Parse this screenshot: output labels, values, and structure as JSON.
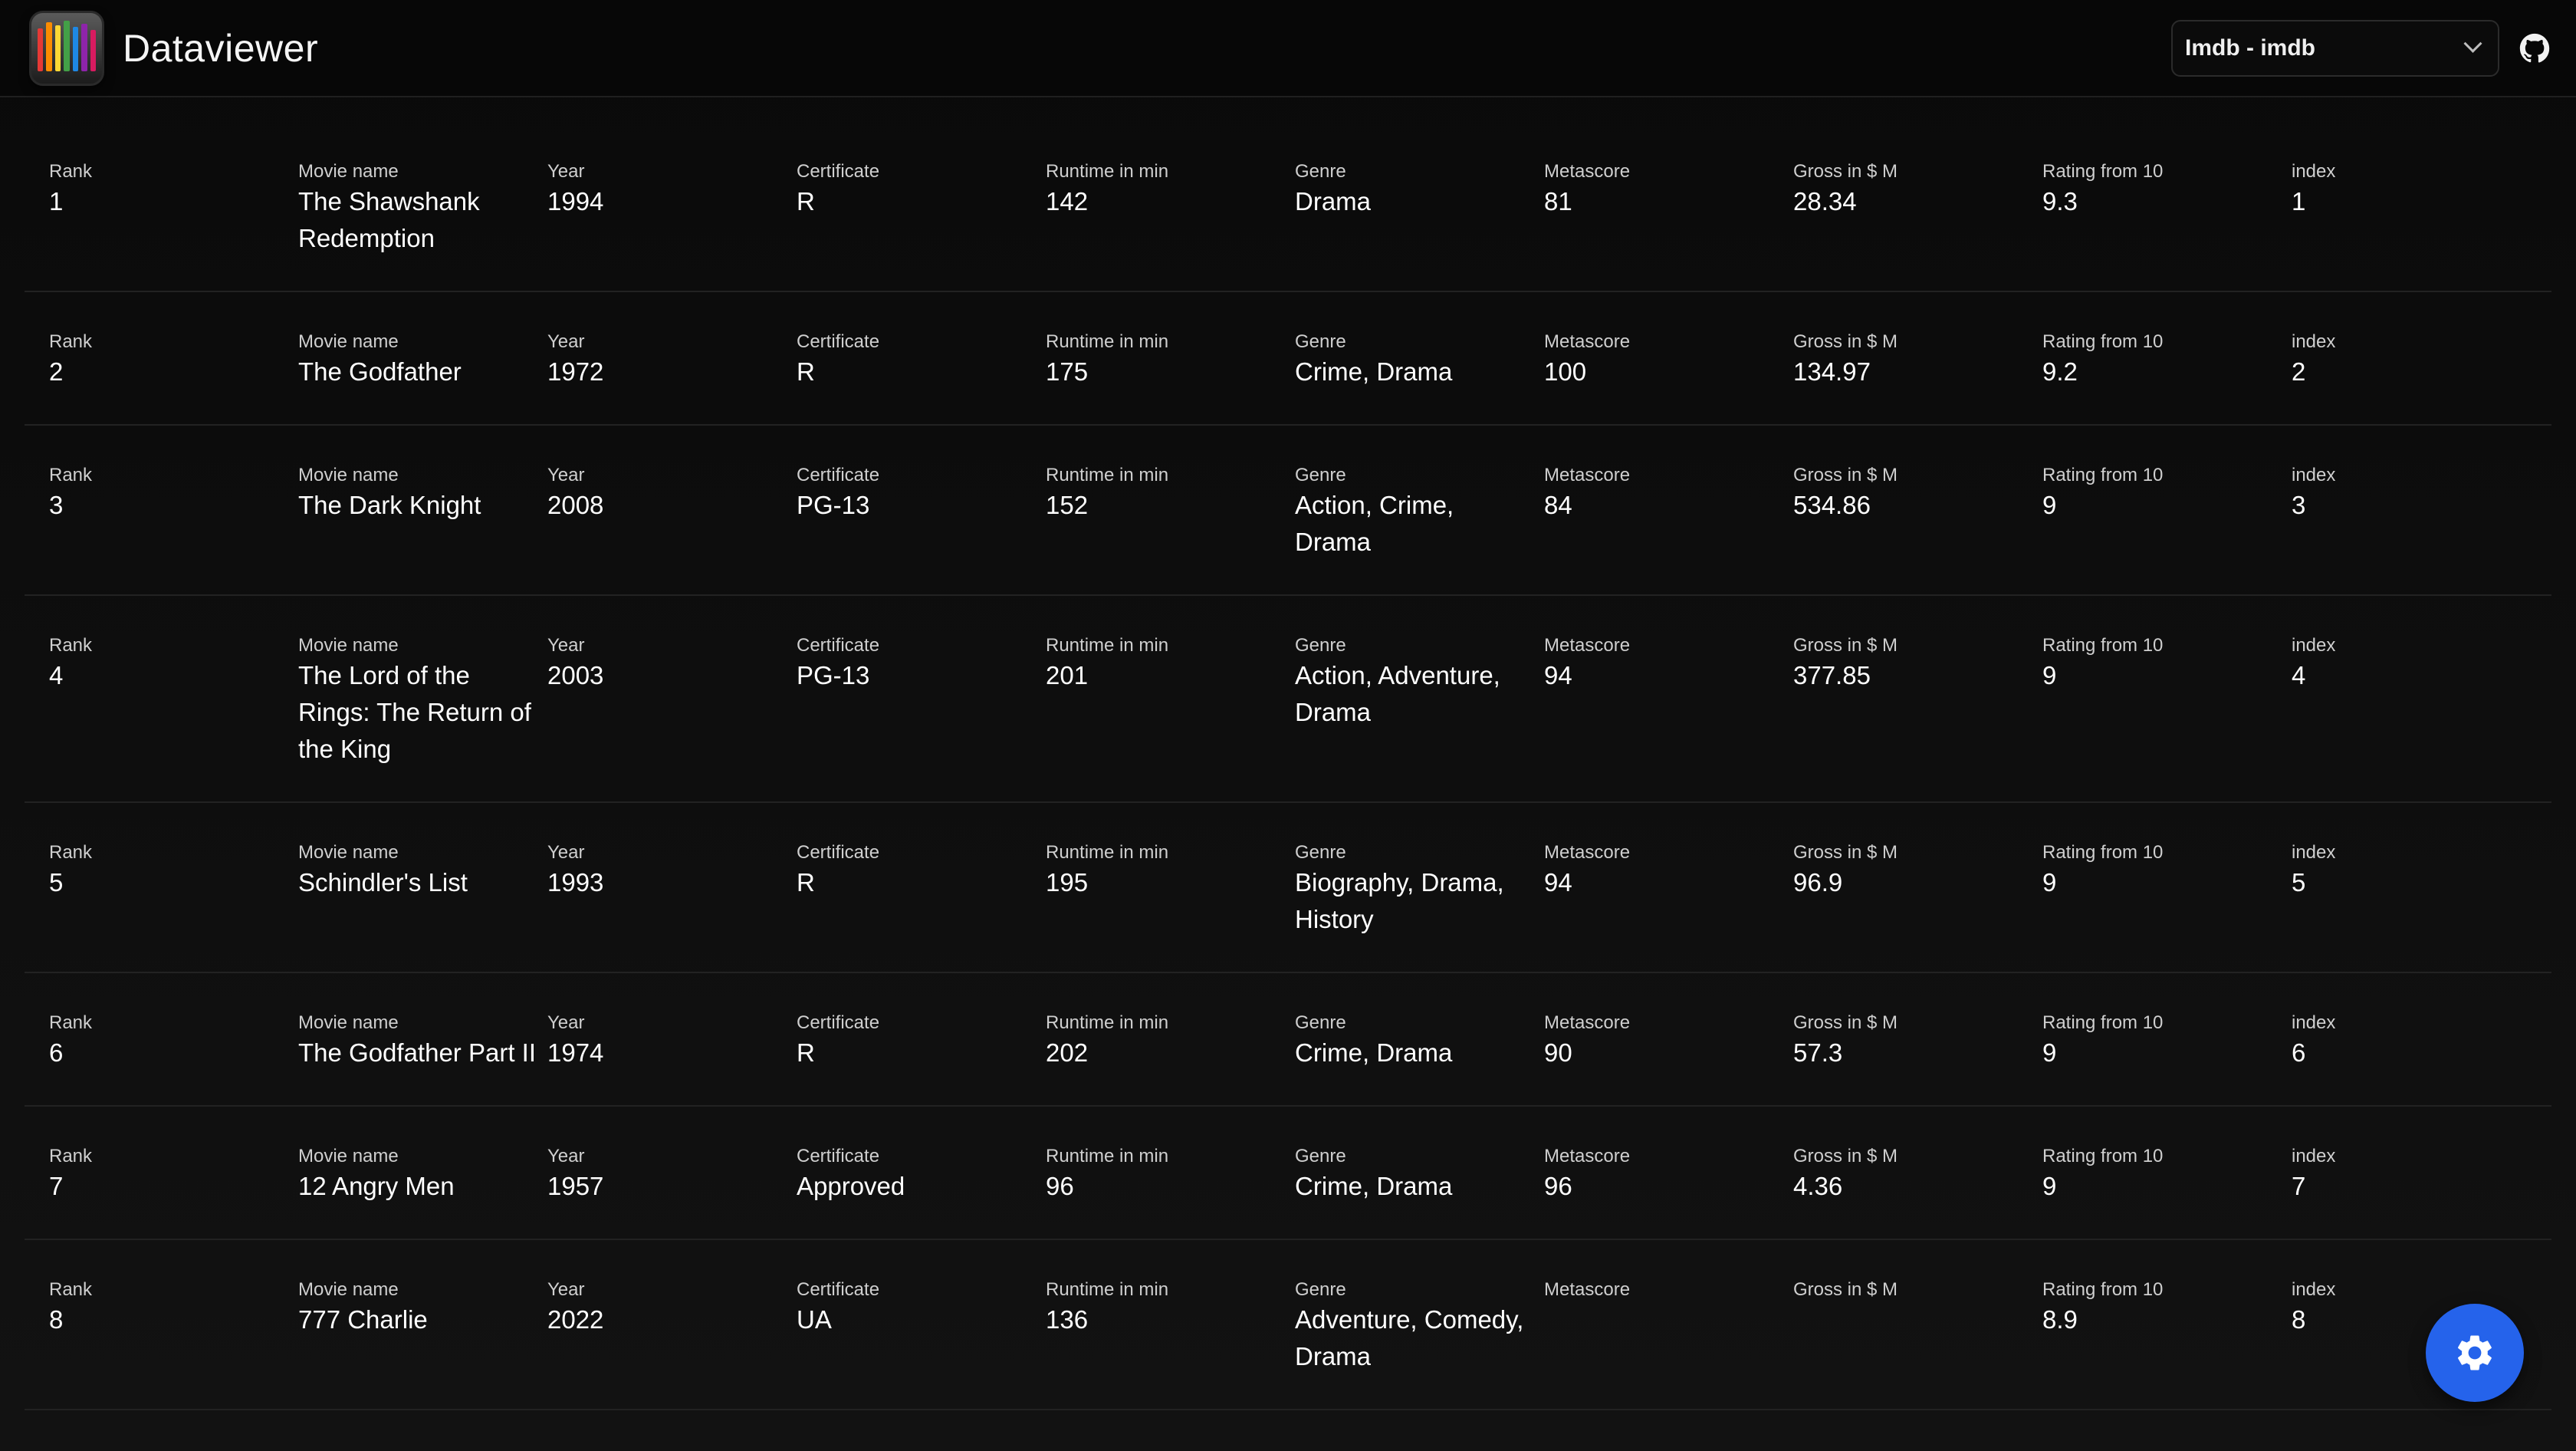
{
  "header": {
    "title": "Dataviewer",
    "dataset_select": "Imdb - imdb",
    "github_icon": "github-icon"
  },
  "columns": [
    "Rank",
    "Movie name",
    "Year",
    "Certificate",
    "Runtime in min",
    "Genre",
    "Metascore",
    "Gross in $ M",
    "Rating from 10",
    "index"
  ],
  "rows": [
    [
      "1",
      "The Shawshank Redemption",
      "1994",
      "R",
      "142",
      "Drama",
      "81",
      "28.34",
      "9.3",
      "1"
    ],
    [
      "2",
      "The Godfather",
      "1972",
      "R",
      "175",
      "Crime, Drama",
      "100",
      "134.97",
      "9.2",
      "2"
    ],
    [
      "3",
      "The Dark Knight",
      "2008",
      "PG-13",
      "152",
      "Action, Crime, Drama",
      "84",
      "534.86",
      "9",
      "3"
    ],
    [
      "4",
      "The Lord of the Rings: The Return of the King",
      "2003",
      "PG-13",
      "201",
      "Action, Adventure, Drama",
      "94",
      "377.85",
      "9",
      "4"
    ],
    [
      "5",
      "Schindler's List",
      "1993",
      "R",
      "195",
      "Biography, Drama, History",
      "94",
      "96.9",
      "9",
      "5"
    ],
    [
      "6",
      "The Godfather Part II",
      "1974",
      "R",
      "202",
      "Crime, Drama",
      "90",
      "57.3",
      "9",
      "6"
    ],
    [
      "7",
      "12 Angry Men",
      "1957",
      "Approved",
      "96",
      "Crime, Drama",
      "96",
      "4.36",
      "9",
      "7"
    ],
    [
      "8",
      "777 Charlie",
      "2022",
      "UA",
      "136",
      "Adventure, Comedy, Drama",
      "",
      "",
      "8.9",
      "8"
    ]
  ],
  "fab": {
    "icon": "gear-icon",
    "color": "#2563eb"
  }
}
